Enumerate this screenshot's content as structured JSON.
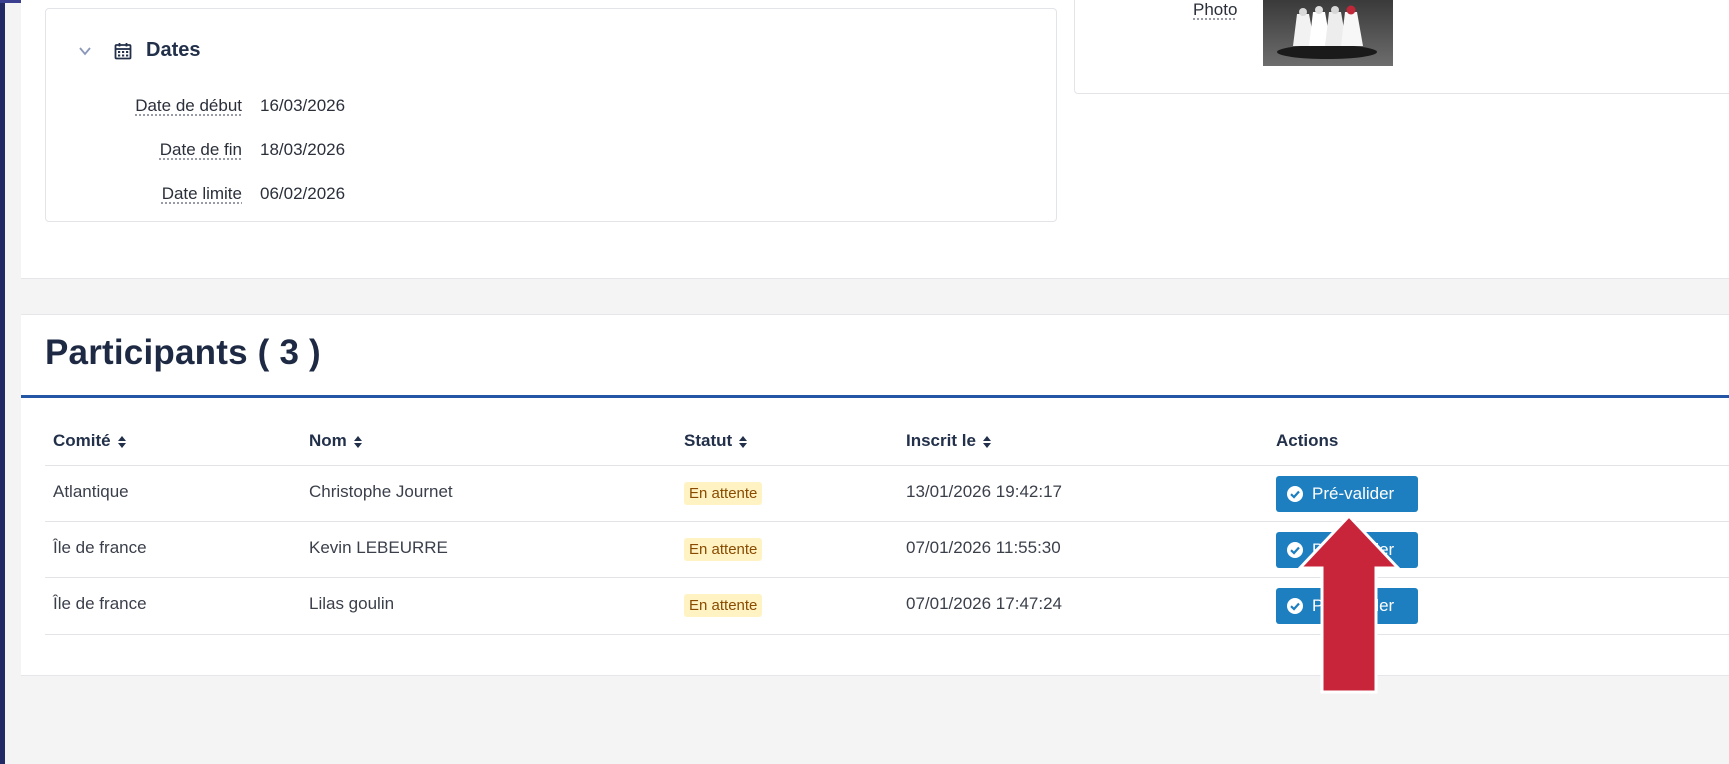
{
  "dates": {
    "title": "Dates",
    "rows": [
      {
        "label": "Date de début",
        "value": "16/03/2026"
      },
      {
        "label": "Date de fin",
        "value": "18/03/2026"
      },
      {
        "label": "Date limite",
        "value": "06/02/2026"
      }
    ]
  },
  "photo": {
    "label": "Photo"
  },
  "participants": {
    "title": "Participants ( 3 )",
    "columns": {
      "committee": "Comité",
      "name": "Nom",
      "status": "Statut",
      "registered": "Inscrit le",
      "actions": "Actions"
    },
    "rows": [
      {
        "committee": "Atlantique",
        "name": "Christophe Journet",
        "status": "En attente",
        "registered": "13/01/2026 19:42:17",
        "action": "Pré-valider"
      },
      {
        "committee": "Île de france",
        "name": "Kevin LEBEURRE",
        "status": "En attente",
        "registered": "07/01/2026 11:55:30",
        "action": "Pré-valider"
      },
      {
        "committee": "Île de france",
        "name": "Lilas goulin",
        "status": "En attente",
        "registered": "07/01/2026 17:47:24",
        "action": "Pré-valider"
      }
    ]
  },
  "colors": {
    "accent": "#2456a6",
    "button": "#1e7fc0",
    "badge_bg": "#fff3c4",
    "annotation": "#c8253a"
  },
  "icons": {
    "collapse": "chevron-down-icon",
    "dates": "calendar-icon",
    "sort": "sort-icon",
    "action": "check-circle-icon"
  }
}
